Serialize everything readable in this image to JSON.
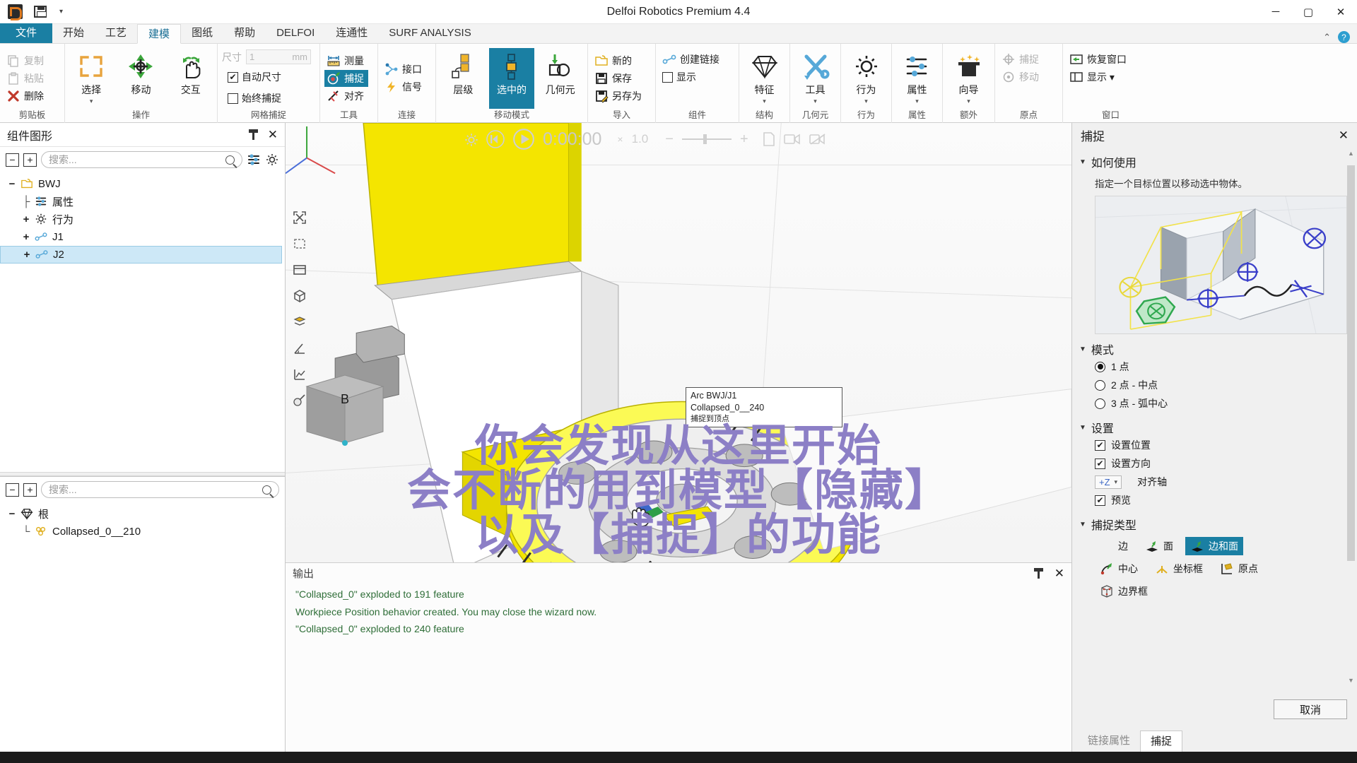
{
  "titlebar": {
    "app_title": "Delfoi Robotics Premium 4.4",
    "quick_access": [
      {
        "name": "app-logo",
        "label": ""
      },
      {
        "name": "save-icon",
        "label": ""
      },
      {
        "name": "customize-qat-caret",
        "label": "▾"
      }
    ],
    "window_controls": {
      "minimize": "─",
      "maximize": "▢",
      "close": "✕"
    }
  },
  "tabs": [
    {
      "id": "file",
      "label": "文件",
      "state": "file"
    },
    {
      "id": "home",
      "label": "开始",
      "state": "normal"
    },
    {
      "id": "process",
      "label": "工艺",
      "state": "normal"
    },
    {
      "id": "modeling",
      "label": "建模",
      "state": "active"
    },
    {
      "id": "drawing",
      "label": "图纸",
      "state": "normal"
    },
    {
      "id": "help",
      "label": "帮助",
      "state": "normal"
    },
    {
      "id": "delfoi",
      "label": "DELFOI",
      "state": "normal"
    },
    {
      "id": "connectivity",
      "label": "连通性",
      "state": "normal"
    },
    {
      "id": "surf",
      "label": "SURF ANALYSIS",
      "state": "normal"
    }
  ],
  "tabstrip_right": {
    "collapse_caret": "⌃",
    "help_label": "?"
  },
  "ribbon": {
    "groups": [
      {
        "id": "clipboard",
        "label": "剪贴板",
        "small_buttons": [
          {
            "label": "复制",
            "icon": "copy-icon",
            "disabled": true
          },
          {
            "label": "粘贴",
            "icon": "paste-icon",
            "disabled": true
          },
          {
            "label": "删除",
            "icon": "delete-icon",
            "disabled": false
          }
        ]
      },
      {
        "id": "operation",
        "label": "操作",
        "big_buttons": [
          {
            "label": "选择",
            "icon": "select-icon",
            "dropdown": true,
            "selected": false
          },
          {
            "label": "移动",
            "icon": "move-icon",
            "dropdown": false,
            "selected": false
          },
          {
            "label": "交互",
            "icon": "interact-icon",
            "dropdown": false,
            "selected": false
          }
        ]
      },
      {
        "id": "grid-snap",
        "label": "网格捕捉",
        "size_label": "尺寸",
        "size_value": "1",
        "size_unit": "mm",
        "checkboxes": [
          {
            "label": "自动尺寸",
            "checked": true
          },
          {
            "label": "始终捕捉",
            "checked": false
          }
        ]
      },
      {
        "id": "tools",
        "label": "工具",
        "small_buttons": [
          {
            "label": "测量",
            "icon": "measure-icon",
            "selected": false
          },
          {
            "label": "捕捉",
            "icon": "snap-icon",
            "selected": true
          },
          {
            "label": "对齐",
            "icon": "align-icon",
            "selected": false
          }
        ]
      },
      {
        "id": "connect",
        "label": "连接",
        "small_buttons": [
          {
            "label": "接口",
            "icon": "interface-icon",
            "selected": false
          },
          {
            "label": "信号",
            "icon": "signal-icon",
            "selected": false
          }
        ]
      },
      {
        "id": "move-mode",
        "label": "移动模式",
        "big_buttons": [
          {
            "label": "层级",
            "icon": "hierarchy-icon",
            "selected": false
          },
          {
            "label": "选中的",
            "icon": "selected-icon",
            "selected": true
          },
          {
            "label": "几何元",
            "icon": "geometry-icon",
            "selected": false
          }
        ]
      },
      {
        "id": "import",
        "label": "导入",
        "small_buttons": [
          {
            "label": "新的",
            "icon": "new-icon"
          },
          {
            "label": "保存",
            "icon": "save-icon"
          },
          {
            "label": "另存为",
            "icon": "save-as-icon"
          }
        ]
      },
      {
        "id": "component",
        "label": "组件",
        "small_buttons": [
          {
            "label": "创建链接",
            "icon": "create-link-icon"
          },
          {
            "label": "显示",
            "icon": "show-checkbox",
            "checkbox": true,
            "checked": false
          }
        ]
      },
      {
        "id": "structure",
        "label": "结构",
        "big_buttons": [
          {
            "label": "特征",
            "icon": "feature-icon",
            "dropdown": true
          },
          {
            "label": "工具",
            "icon": "tools-icon",
            "dropdown": true
          }
        ]
      },
      {
        "id": "geometry",
        "label": "几何元",
        "big_buttons": []
      },
      {
        "id": "behaviour",
        "label": "行为",
        "big_buttons": [
          {
            "label": "行为",
            "icon": "behaviour-gear-icon",
            "dropdown": true
          }
        ]
      },
      {
        "id": "properties",
        "label": "属性",
        "big_buttons": [
          {
            "label": "属性",
            "icon": "properties-icon",
            "dropdown": true
          }
        ]
      },
      {
        "id": "extra",
        "label": "额外",
        "big_buttons": [
          {
            "label": "向导",
            "icon": "wizard-icon",
            "dropdown": true
          }
        ]
      },
      {
        "id": "origin",
        "label": "原点",
        "small_buttons": [
          {
            "label": "捕捉",
            "icon": "origin-snap-icon",
            "disabled": true
          },
          {
            "label": "移动",
            "icon": "origin-move-icon",
            "disabled": true
          }
        ]
      },
      {
        "id": "window",
        "label": "窗口",
        "small_buttons": [
          {
            "label": "恢复窗口",
            "icon": "restore-window-icon"
          },
          {
            "label": "显示 ▾",
            "icon": "show-window-icon"
          }
        ]
      }
    ]
  },
  "left_panel": {
    "title": "组件图形",
    "pin_icon": "pin-icon",
    "close_icon": "close-icon",
    "search_placeholder": "搜索...",
    "collapse_all": "−",
    "expand_all": "+",
    "tree": [
      {
        "depth": 0,
        "expander": "−",
        "icon": "component-icon",
        "label": "BWJ",
        "selected": false
      },
      {
        "depth": 1,
        "expander": "",
        "icon": "properties-icon",
        "label": "属性",
        "selected": false
      },
      {
        "depth": 1,
        "expander": "+",
        "icon": "behaviour-gear-icon",
        "label": "行为",
        "selected": false
      },
      {
        "depth": 1,
        "expander": "+",
        "icon": "link-icon",
        "label": "J1",
        "selected": false
      },
      {
        "depth": 1,
        "expander": "+",
        "icon": "link-icon",
        "label": "J2",
        "selected": true
      }
    ]
  },
  "left_lower_panel": {
    "search_placeholder": "搜索...",
    "collapse_all": "−",
    "expand_all": "+",
    "tree": [
      {
        "depth": 0,
        "expander": "−",
        "icon": "feature-icon",
        "label": "根",
        "selected": false
      },
      {
        "depth": 1,
        "expander": "",
        "icon": "geometry-set-icon",
        "label": "Collapsed_0__210",
        "selected": false
      }
    ]
  },
  "viewport": {
    "playback": {
      "settings_icon": "gear-icon",
      "rewind_icon": "rewind-icon",
      "play_icon": "play-icon",
      "time": "0:00:00",
      "speed_x": "×",
      "speed_value": "1.0",
      "minus": "−",
      "plus": "+",
      "pdf_icon": "pdf-icon",
      "camera_icon": "camera-icon",
      "record_icon": "record-icon"
    },
    "side_tools": [
      "fit-view-icon",
      "select-rect-icon",
      "view-2d-icon",
      "view-box-icon",
      "view-layers-icon",
      "measure-angle-icon",
      "measure-chart-icon",
      "color-picker-icon"
    ],
    "snap_tooltip": [
      "Arc                  BWJ/J1",
      "Collapsed_0__240",
      "捕捉到顶点"
    ],
    "cube_label": "B"
  },
  "output_panel": {
    "title": "输出",
    "pin_icon": "pin-icon",
    "close_icon": "close-icon",
    "lines": [
      "\"Collapsed_0\" exploded to 191 feature",
      "Workpiece Position behavior created. You may close the wizard now.",
      "\"Collapsed_0\" exploded to 240 feature"
    ]
  },
  "right_panel": {
    "title": "捕捉",
    "close_icon": "close-icon",
    "sections": [
      {
        "id": "howto",
        "label": "如何使用"
      },
      {
        "id": "mode",
        "label": "模式"
      },
      {
        "id": "settings",
        "label": "设置"
      },
      {
        "id": "snaptype",
        "label": "捕捉类型"
      }
    ],
    "howto_text": "指定一个目标位置以移动选中物体。",
    "modes": [
      {
        "label": "1 点",
        "selected": true
      },
      {
        "label": "2 点 - 中点",
        "selected": false
      },
      {
        "label": "3 点 - 弧中心",
        "selected": false
      }
    ],
    "settings": [
      {
        "label": "设置位置",
        "checked": true
      },
      {
        "label": "设置方向",
        "checked": true
      }
    ],
    "align_axis": {
      "value": "+Z",
      "label": "对齐轴",
      "caret": "▾"
    },
    "preview": {
      "label": "预览",
      "checked": true
    },
    "snap_types": [
      {
        "label": "边",
        "icon": "snap-edge-icon",
        "selected": false
      },
      {
        "label": "面",
        "icon": "snap-face-icon",
        "selected": false
      },
      {
        "label": "边和面",
        "icon": "snap-edge-face-icon",
        "selected": true
      },
      {
        "label": "中心",
        "icon": "snap-center-icon",
        "selected": false
      },
      {
        "label": "坐标框",
        "icon": "snap-frame-icon",
        "selected": false
      },
      {
        "label": "原点",
        "icon": "snap-origin-icon",
        "selected": false
      },
      {
        "label": "边界框",
        "icon": "snap-boundingbox-icon",
        "selected": false
      }
    ],
    "cancel_label": "取消",
    "tabs": [
      {
        "label": "链接属性",
        "active": false
      },
      {
        "label": "捕捉",
        "active": true
      }
    ]
  },
  "overlay_subtitle": [
    "你会发现从这里开始",
    "会不断的用到模型【隐藏】",
    "以及【捕捉】的功能"
  ],
  "colors": {
    "accent": "#1a7fa3",
    "selection": "#cde8f7",
    "overlay_text": "#8c7fc6",
    "log_text": "#2f6e38",
    "model_yellow": "#f4e500"
  }
}
